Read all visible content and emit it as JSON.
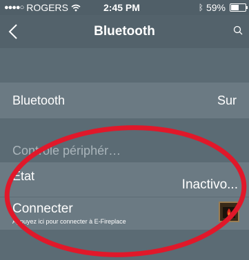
{
  "status_bar": {
    "carrier": "ROGERS",
    "time": "2:45 PM",
    "battery": "59%",
    "battery_level": 0.59
  },
  "nav": {
    "title": "Bluetooth"
  },
  "settings": {
    "bluetooth_label": "Bluetooth",
    "bluetooth_value": "Sur"
  },
  "section": {
    "header": "Contrôle périphér…"
  },
  "state_row": {
    "label": "État",
    "value": "Inactivo..."
  },
  "connect_row": {
    "label": "Connecter",
    "subtitle": "Appuyez ici pour connecter à E-Fireplace"
  },
  "colors": {
    "background": "#5b6b74",
    "row": "#6b7a83",
    "annotation": "#e0182a"
  }
}
